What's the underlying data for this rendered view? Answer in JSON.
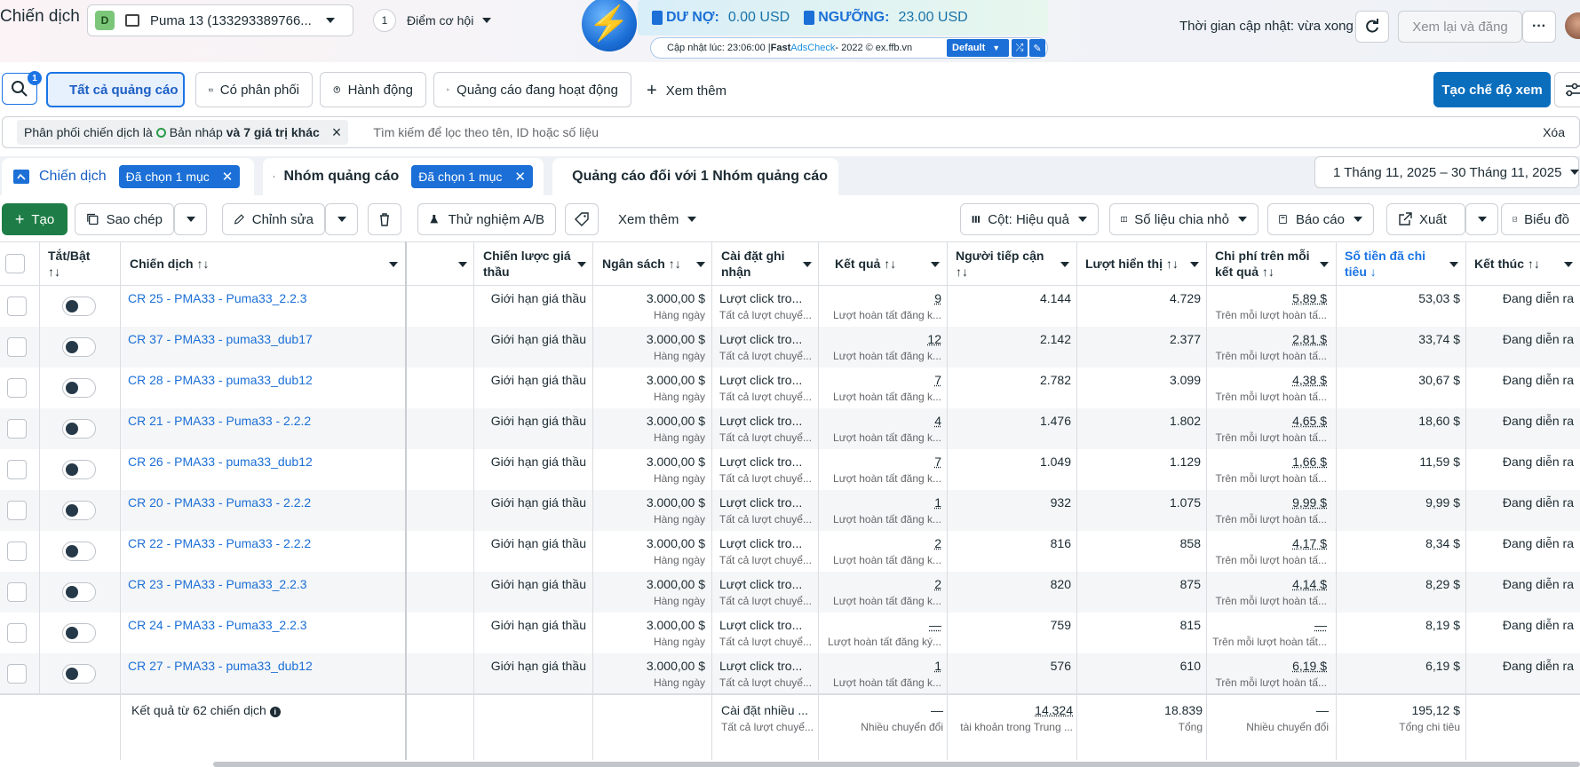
{
  "header": {
    "title": "Chiến dịch",
    "account_badge": "D",
    "account_name": "Puma 13 (133293389766...",
    "opportunity_count": "1",
    "opportunity_label": "Điểm cơ hội",
    "updated_text": "Thời gian cập nhật: vừa xong",
    "review_button": "Xem lại và đăng"
  },
  "extension": {
    "debt_label": "DƯ NỢ:",
    "debt_value": "0.00 USD",
    "threshold_label": "NGƯỠNG:",
    "threshold_value": "23.00 USD",
    "sub_prefix": "Cập nhật lúc: 23:06:00 | ",
    "sub_fast": "Fast ",
    "sub_brand": "AdsCheck",
    "sub_suffix": " - 2022 © ex.ffb.vn",
    "default_label": "Default",
    "bolt_glyph": "⚡"
  },
  "filter_tabs": {
    "search_badge": "1",
    "all_ads": "Tất cả quảng cáo",
    "delivering": "Có phân phối",
    "actions": "Hành động",
    "active_ads": "Quảng cáo đang hoạt động",
    "see_more": "Xem thêm",
    "create_view": "Tạo chế độ xem"
  },
  "filter_bar": {
    "chip_prefix": "Phân phối chiến dịch là",
    "chip_draft": "Bản nháp",
    "chip_more": "và 7 giá trị khác",
    "placeholder": "Tìm kiếm để lọc theo tên, ID hoặc số liệu",
    "clear": "Xóa"
  },
  "level_tabs": {
    "campaigns": "Chiến dịch",
    "campaigns_selected": "Đã chọn 1 mục",
    "adsets": "Nhóm quảng cáo",
    "adsets_selected": "Đã chọn 1 mục",
    "ads": "Quảng cáo đối với 1 Nhóm quảng cáo",
    "date_range": "1 Tháng 11, 2025 – 30 Tháng 11, 2025"
  },
  "toolbar": {
    "create": "Tạo",
    "duplicate": "Sao chép",
    "edit": "Chỉnh sửa",
    "ab_test": "Thử nghiệm A/B",
    "more": "Xem thêm",
    "columns": "Cột: Hiệu quả",
    "breakdown": "Số liệu chia nhỏ",
    "reports": "Báo cáo",
    "export": "Xuất",
    "charts": "Biểu đồ"
  },
  "columns": {
    "toggle": "Tắt/Bật",
    "toggle_sort": "↑↓",
    "campaign": "Chiến dịch ↑↓",
    "bid_strategy_1": "Chiến lược giá",
    "bid_strategy_2": "thầu",
    "budget": "Ngân sách ↑↓",
    "attribution_1": "Cài đặt ghi",
    "attribution_2": "nhận",
    "results": "Kết quả ↑↓",
    "reach_1": "Người tiếp cận",
    "reach_2": "↑↓",
    "impressions": "Lượt hiển thị ↑↓",
    "cpr_1": "Chi phí trên mỗi",
    "cpr_2": "kết quả ↑↓",
    "spent_1": "Số tiền đã chi",
    "spent_2": "tiêu ↓",
    "ends": "Kết thúc ↑↓"
  },
  "rows": [
    {
      "name": "CR 25 - PMA33 - Puma33_2.2.3",
      "bid": "Giới hạn giá thầu",
      "budget": "3.000,00 $",
      "budget_sub": "Hàng ngày",
      "attr": "Lượt click tro...",
      "attr_sub": "Tất cả lượt chuyể...",
      "result": "9",
      "result_sub": "Lượt hoàn tất đăng k...",
      "reach": "4.144",
      "impr": "4.729",
      "cpr": "5,89 $",
      "cpr_sub": "Trên mỗi lượt hoàn tấ...",
      "spent": "53,03 $",
      "ends": "Đang diễn ra"
    },
    {
      "name": "CR 37 - PMA33 - puma33_dub17",
      "bid": "Giới hạn giá thầu",
      "budget": "3.000,00 $",
      "budget_sub": "Hàng ngày",
      "attr": "Lượt click tro...",
      "attr_sub": "Tất cả lượt chuyể...",
      "result": "12",
      "result_sub": "Lượt hoàn tất đăng k...",
      "reach": "2.142",
      "impr": "2.377",
      "cpr": "2,81 $",
      "cpr_sub": "Trên mỗi lượt hoàn tấ...",
      "spent": "33,74 $",
      "ends": "Đang diễn ra"
    },
    {
      "name": "CR 28 - PMA33 - puma33_dub12",
      "bid": "Giới hạn giá thầu",
      "budget": "3.000,00 $",
      "budget_sub": "Hàng ngày",
      "attr": "Lượt click tro...",
      "attr_sub": "Tất cả lượt chuyể...",
      "result": "7",
      "result_sub": "Lượt hoàn tất đăng k...",
      "reach": "2.782",
      "impr": "3.099",
      "cpr": "4,38 $",
      "cpr_sub": "Trên mỗi lượt hoàn tấ...",
      "spent": "30,67 $",
      "ends": "Đang diễn ra"
    },
    {
      "name": "CR 21 - PMA33 - Puma33 - 2.2.2",
      "bid": "Giới hạn giá thầu",
      "budget": "3.000,00 $",
      "budget_sub": "Hàng ngày",
      "attr": "Lượt click tro...",
      "attr_sub": "Tất cả lượt chuyể...",
      "result": "4",
      "result_sub": "Lượt hoàn tất đăng k...",
      "reach": "1.476",
      "impr": "1.802",
      "cpr": "4,65 $",
      "cpr_sub": "Trên mỗi lượt hoàn tấ...",
      "spent": "18,60 $",
      "ends": "Đang diễn ra"
    },
    {
      "name": "CR 26 - PMA33 - puma33_dub12",
      "bid": "Giới hạn giá thầu",
      "budget": "3.000,00 $",
      "budget_sub": "Hàng ngày",
      "attr": "Lượt click tro...",
      "attr_sub": "Tất cả lượt chuyể...",
      "result": "7",
      "result_sub": "Lượt hoàn tất đăng k...",
      "reach": "1.049",
      "impr": "1.129",
      "cpr": "1,66 $",
      "cpr_sub": "Trên mỗi lượt hoàn tấ...",
      "spent": "11,59 $",
      "ends": "Đang diễn ra"
    },
    {
      "name": "CR 20 - PMA33 - Puma33 - 2.2.2",
      "bid": "Giới hạn giá thầu",
      "budget": "3.000,00 $",
      "budget_sub": "Hàng ngày",
      "attr": "Lượt click tro...",
      "attr_sub": "Tất cả lượt chuyể...",
      "result": "1",
      "result_sub": "Lượt hoàn tất đăng k...",
      "reach": "932",
      "impr": "1.075",
      "cpr": "9,99 $",
      "cpr_sub": "Trên mỗi lượt hoàn tấ...",
      "spent": "9,99 $",
      "ends": "Đang diễn ra"
    },
    {
      "name": "CR 22 - PMA33 - Puma33 - 2.2.2",
      "bid": "Giới hạn giá thầu",
      "budget": "3.000,00 $",
      "budget_sub": "Hàng ngày",
      "attr": "Lượt click tro...",
      "attr_sub": "Tất cả lượt chuyể...",
      "result": "2",
      "result_sub": "Lượt hoàn tất đăng k...",
      "reach": "816",
      "impr": "858",
      "cpr": "4,17 $",
      "cpr_sub": "Trên mỗi lượt hoàn tấ...",
      "spent": "8,34 $",
      "ends": "Đang diễn ra"
    },
    {
      "name": "CR 23 - PMA33 - Puma33_2.2.3",
      "bid": "Giới hạn giá thầu",
      "budget": "3.000,00 $",
      "budget_sub": "Hàng ngày",
      "attr": "Lượt click tro...",
      "attr_sub": "Tất cả lượt chuyể...",
      "result": "2",
      "result_sub": "Lượt hoàn tất đăng k...",
      "reach": "820",
      "impr": "875",
      "cpr": "4,14 $",
      "cpr_sub": "Trên mỗi lượt hoàn tấ...",
      "spent": "8,29 $",
      "ends": "Đang diễn ra"
    },
    {
      "name": "CR 24 - PMA33 - Puma33_2.2.3",
      "bid": "Giới hạn giá thầu",
      "budget": "3.000,00 $",
      "budget_sub": "Hàng ngày",
      "attr": "Lượt click tro...",
      "attr_sub": "Tất cả lượt chuyể...",
      "result": "—",
      "result_sub": "Lượt hoàn tất đăng ký...",
      "reach": "759",
      "impr": "815",
      "cpr": "—",
      "cpr_sub": "Trên mỗi lượt hoàn tất...",
      "spent": "8,19 $",
      "ends": "Đang diễn ra"
    },
    {
      "name": "CR 27 - PMA33 - puma33_dub12",
      "bid": "Giới hạn giá thầu",
      "budget": "3.000,00 $",
      "budget_sub": "Hàng ngày",
      "attr": "Lượt click tro...",
      "attr_sub": "Tất cả lượt chuyể...",
      "result": "1",
      "result_sub": "Lượt hoàn tất đăng k...",
      "reach": "576",
      "impr": "610",
      "cpr": "6,19 $",
      "cpr_sub": "Trên mỗi lượt hoàn tấ...",
      "spent": "6,19 $",
      "ends": "Đang diễn ra"
    }
  ],
  "footer": {
    "label": "Kết quả từ 62 chiến dịch",
    "attr": "Cài đặt nhiều ...",
    "attr_sub": "Tất cả lượt chuyể...",
    "result": "—",
    "result_sub": "Nhiều chuyển đổi",
    "reach": "14.324",
    "reach_sub": "tài khoản trong Trung ...",
    "impr": "18.839",
    "impr_sub": "Tổng",
    "cpr": "—",
    "cpr_sub": "Nhiều chuyển đổi",
    "spent": "195,12 $",
    "spent_sub": "Tổng chi tiêu"
  },
  "colors": {
    "accent": "#1b74e4",
    "create_green": "#1e7d46",
    "link": "#1b6fd6"
  },
  "icons": [
    "search-icon",
    "folder-icon",
    "envelope-icon",
    "action-icon",
    "send-icon",
    "plus-icon",
    "filter-settings-icon",
    "calendar-icon",
    "duplicate-icon",
    "pencil-icon",
    "trash-icon",
    "flask-icon",
    "tag-icon",
    "columns-icon",
    "breakdown-icon",
    "report-icon",
    "export-icon",
    "chart-icon",
    "refresh-icon",
    "more-icon",
    "info-icon",
    "bolt-icon"
  ]
}
